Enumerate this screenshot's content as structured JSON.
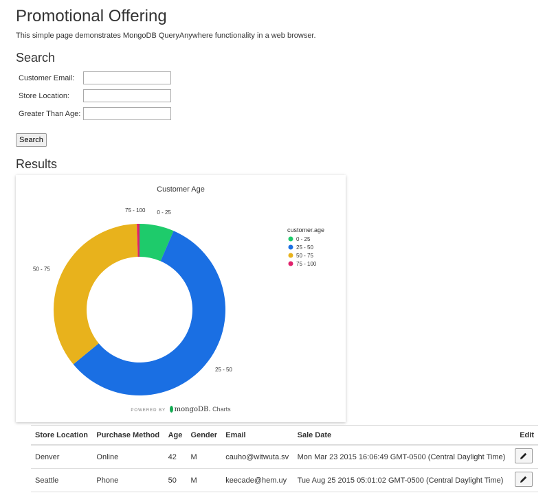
{
  "page": {
    "title": "Promotional Offering",
    "description": "This simple page demonstrates MongoDB QueryAnywhere functionality in a web browser."
  },
  "search": {
    "heading": "Search",
    "fields": [
      {
        "label": "Customer Email:",
        "value": ""
      },
      {
        "label": "Store Location:",
        "value": ""
      },
      {
        "label": "Greater Than Age:",
        "value": ""
      }
    ],
    "button_label": "Search"
  },
  "results": {
    "heading": "Results",
    "columns": [
      "Store Location",
      "Purchase Method",
      "Age",
      "Gender",
      "Email",
      "Sale Date",
      "Edit"
    ],
    "rows": [
      {
        "store_location": "Denver",
        "purchase_method": "Online",
        "age": "42",
        "gender": "M",
        "email": "cauho@witwuta.sv",
        "sale_date": "Mon Mar 23 2015 16:06:49 GMT-0500 (Central Daylight Time)",
        "edit_icon": "pencil-icon"
      },
      {
        "store_location": "Seattle",
        "purchase_method": "Phone",
        "age": "50",
        "gender": "M",
        "email": "keecade@hem.uy",
        "sale_date": "Tue Aug 25 2015 05:01:02 GMT-0500 (Central Daylight Time)",
        "edit_icon": "pencil-icon"
      }
    ]
  },
  "chart_data": {
    "type": "pie",
    "title": "Customer Age",
    "legend_title": "customer.age",
    "legend_position": "right",
    "categories": [
      "0 - 25",
      "25 - 50",
      "50 - 75",
      "75 - 100"
    ],
    "values": [
      6.5,
      57.5,
      35.5,
      0.5
    ],
    "colors": [
      "#1ecb6b",
      "#1a6fe3",
      "#e8b21c",
      "#e0216b"
    ]
  },
  "chart_footer": {
    "powered_by": "POWERED BY",
    "brand": "mongoDB.",
    "product": "Charts"
  }
}
